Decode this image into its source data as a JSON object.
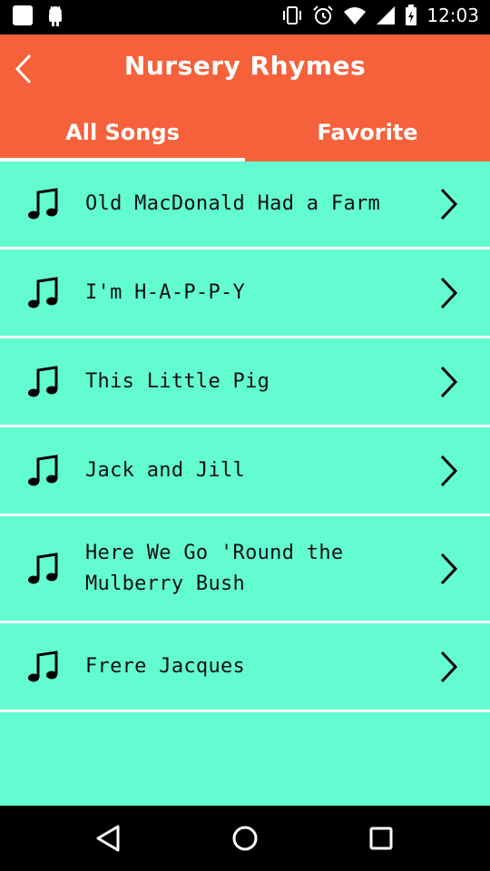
{
  "status_bar": {
    "time": "12:03",
    "icons": [
      "notification-square-icon",
      "android-icon",
      "vibrate-icon",
      "alarm-icon",
      "wifi-icon",
      "signal-icon",
      "battery-icon"
    ]
  },
  "header": {
    "title": "Nursery Rhymes",
    "background_color": "#f5613b"
  },
  "tabs": [
    {
      "label": "All Songs",
      "active": true
    },
    {
      "label": "Favorite",
      "active": false
    }
  ],
  "songs": {
    "background_color": "#63fbd0",
    "items": [
      {
        "title": "Old MacDonald Had a Farm"
      },
      {
        "title": "I'm H-A-P-P-Y"
      },
      {
        "title": "This Little Pig"
      },
      {
        "title": "Jack and Jill"
      },
      {
        "title": "Here We Go 'Round the Mulberry Bush"
      },
      {
        "title": "Frere Jacques"
      }
    ]
  },
  "nav": {
    "buttons": [
      "back-triangle-icon",
      "home-circle-icon",
      "recents-square-icon"
    ]
  }
}
